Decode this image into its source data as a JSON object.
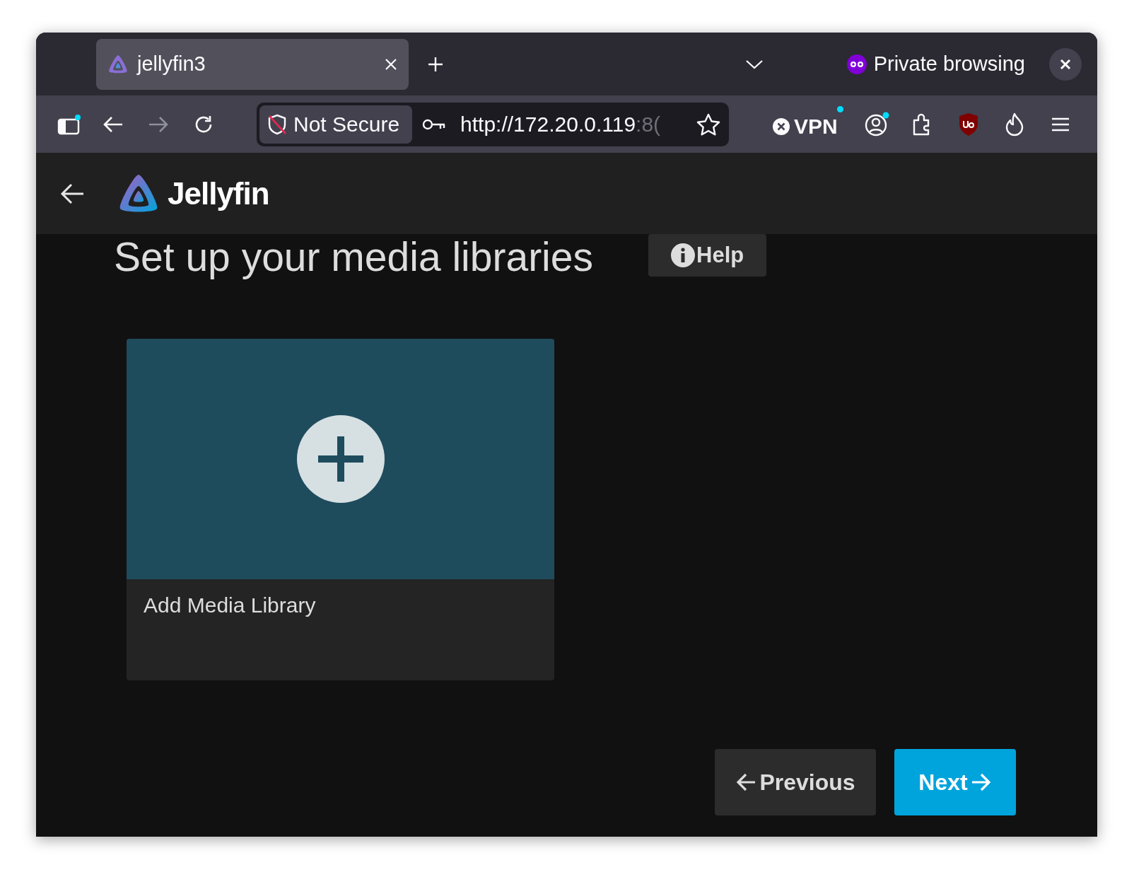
{
  "browser": {
    "tabs": [
      {
        "title": "jellyfin3",
        "selected": true
      }
    ],
    "private_label": "Private browsing",
    "security_label": "Not Secure",
    "url_host": "http://172.20.0.119",
    "url_rest": ":8(",
    "vpn_label": "VPN"
  },
  "app": {
    "logo_text": "Jellyfin"
  },
  "page": {
    "heading": "Set up your media libraries",
    "help_label": "Help",
    "cards": [
      {
        "title": "Add Media Library"
      }
    ],
    "buttons": [
      {
        "kind": "previous",
        "label": "Previous"
      },
      {
        "kind": "next",
        "label": "Next"
      }
    ]
  }
}
